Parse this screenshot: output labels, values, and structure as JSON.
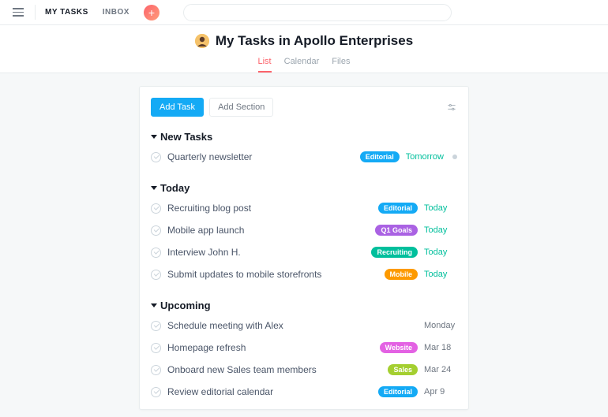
{
  "topnav": {
    "my_tasks": "MY TASKS",
    "inbox": "INBOX"
  },
  "search": {
    "placeholder": ""
  },
  "header": {
    "title": "My Tasks in Apollo Enterprises"
  },
  "tabs": {
    "list": "List",
    "calendar": "Calendar",
    "files": "Files"
  },
  "buttons": {
    "add_task": "Add Task",
    "add_section": "Add Section"
  },
  "sections": {
    "new_tasks": {
      "title": "New Tasks",
      "items": [
        {
          "title": "Quarterly newsletter",
          "tag": "Editorial",
          "tag_color": "#14aaf5",
          "due": "Tomorrow",
          "due_soon": true,
          "follow": true
        }
      ]
    },
    "today": {
      "title": "Today",
      "items": [
        {
          "title": "Recruiting blog post",
          "tag": "Editorial",
          "tag_color": "#14aaf5",
          "due": "Today",
          "due_soon": true
        },
        {
          "title": "Mobile app launch",
          "tag": "Q1 Goals",
          "tag_color": "#aa62e3",
          "due": "Today",
          "due_soon": true
        },
        {
          "title": "Interview John H.",
          "tag": "Recruiting",
          "tag_color": "#00bf9c",
          "due": "Today",
          "due_soon": true
        },
        {
          "title": "Submit updates to mobile storefronts",
          "tag": "Mobile",
          "tag_color": "#fd9a00",
          "due": "Today",
          "due_soon": true
        }
      ]
    },
    "upcoming": {
      "title": "Upcoming",
      "items": [
        {
          "title": "Schedule meeting with Alex",
          "tag": "",
          "tag_color": "",
          "due": "Monday",
          "due_soon": false
        },
        {
          "title": "Homepage refresh",
          "tag": "Website",
          "tag_color": "#e362e3",
          "due": "Mar 18",
          "due_soon": false
        },
        {
          "title": "Onboard new Sales team members",
          "tag": "Sales",
          "tag_color": "#a4cf30",
          "due": "Mar 24",
          "due_soon": false
        },
        {
          "title": "Review editorial calendar",
          "tag": "Editorial",
          "tag_color": "#14aaf5",
          "due": "Apr 9",
          "due_soon": false
        }
      ]
    }
  }
}
